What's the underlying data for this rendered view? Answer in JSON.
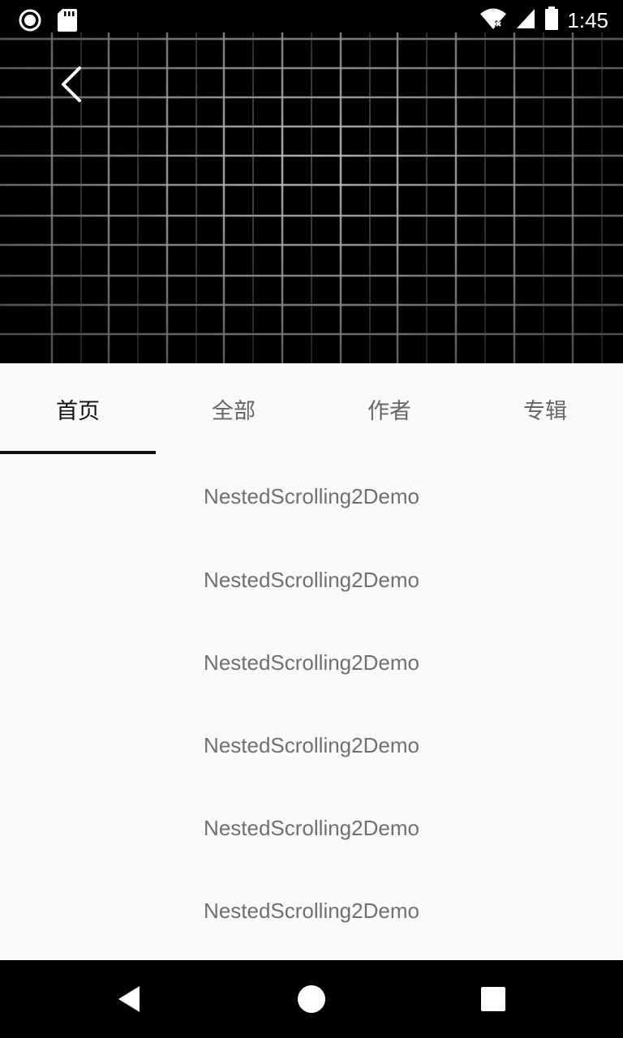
{
  "status_bar": {
    "time": "1:45",
    "icons": [
      "record-icon",
      "sd-card-icon",
      "wifi-icon",
      "cell-signal-icon",
      "battery-icon"
    ]
  },
  "header": {
    "back_icon": "chevron-left-icon",
    "background": "grid-pattern-image"
  },
  "tabs": [
    {
      "label": "首页",
      "active": true
    },
    {
      "label": "全部",
      "active": false
    },
    {
      "label": "作者",
      "active": false
    },
    {
      "label": "专辑",
      "active": false
    }
  ],
  "list": {
    "items": [
      {
        "label": "NestedScrolling2Demo"
      },
      {
        "label": "NestedScrolling2Demo"
      },
      {
        "label": "NestedScrolling2Demo"
      },
      {
        "label": "NestedScrolling2Demo"
      },
      {
        "label": "NestedScrolling2Demo"
      },
      {
        "label": "NestedScrolling2Demo"
      }
    ]
  },
  "nav_bar": {
    "icons": [
      "back-triangle-icon",
      "home-circle-icon",
      "recents-square-icon"
    ]
  },
  "colors": {
    "header_bg": "#000000",
    "grid_line": "#d8d8d8",
    "page_bg": "#fafafa",
    "active_tab": "#111111",
    "inactive_tab": "#666666",
    "list_text": "#707070"
  }
}
